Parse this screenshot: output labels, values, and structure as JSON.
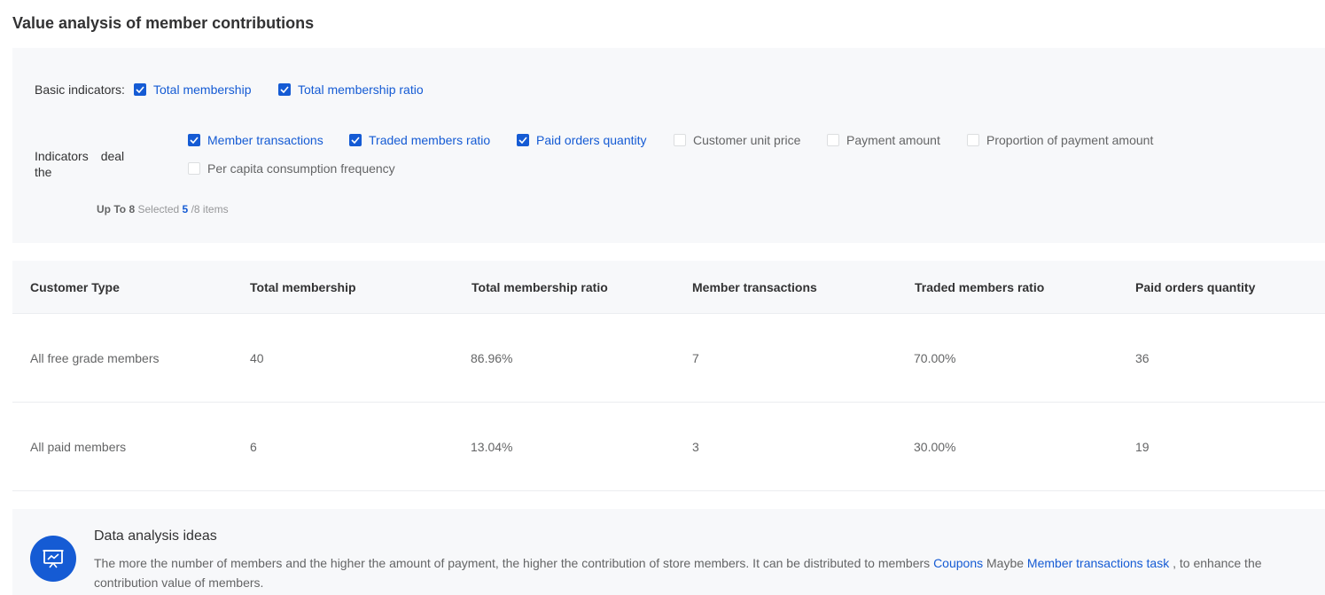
{
  "page": {
    "title": "Value analysis of member contributions"
  },
  "filters": {
    "basic_label": "Basic indicators:",
    "deal_label": "Indicators　deal the",
    "basic_items": [
      {
        "label": "Total membership",
        "checked": true
      },
      {
        "label": "Total membership ratio",
        "checked": true
      }
    ],
    "deal_items": [
      {
        "label": "Member transactions",
        "checked": true
      },
      {
        "label": "Traded members ratio",
        "checked": true
      },
      {
        "label": "Paid orders quantity",
        "checked": true
      },
      {
        "label": "Customer unit price",
        "checked": false
      },
      {
        "label": "Payment amount",
        "checked": false
      },
      {
        "label": "Proportion of payment amount",
        "checked": false
      },
      {
        "label": "Per capita consumption frequency",
        "checked": false
      }
    ],
    "limit": {
      "prefix": "Up To",
      "max": "8",
      "selected_text": "Selected",
      "selected_count": "5",
      "suffix": "/8 items"
    }
  },
  "table": {
    "columns": [
      "Customer Type",
      "Total membership",
      "Total membership ratio",
      "Member transactions",
      "Traded members ratio",
      "Paid orders quantity"
    ],
    "rows": [
      [
        "All free grade members",
        "40",
        "86.96%",
        "7",
        "70.00%",
        "36"
      ],
      [
        "All paid members",
        "6",
        "13.04%",
        "3",
        "30.00%",
        "19"
      ]
    ]
  },
  "ideas": {
    "title": "Data analysis ideas",
    "text_1": "The more the number of members and the higher the amount of payment, the higher the contribution of store members. It can be distributed to members",
    "link_1": "Coupons",
    "text_2": "Maybe",
    "link_2": "Member transactions task",
    "text_3": ", to enhance the contribution value of members.",
    "icon": "presentation-chart-icon"
  },
  "colors": {
    "accent": "#155bd4",
    "panel_bg": "#f7f8fa",
    "text_primary": "#323233",
    "text_secondary": "#646566"
  }
}
